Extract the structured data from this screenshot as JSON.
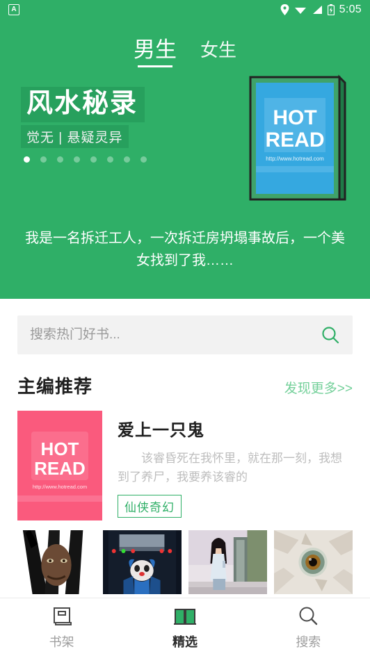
{
  "status_bar": {
    "app_icon": "app-badge-icon",
    "icons": [
      "location-pin-icon",
      "wifi-icon",
      "signal-icon",
      "battery-icon"
    ],
    "time": "5:05"
  },
  "tabs": [
    {
      "label": "男生",
      "active": true
    },
    {
      "label": "女生",
      "active": false
    }
  ],
  "hero": {
    "title": "风水秘录",
    "subtitle": "觉无 | 悬疑灵异",
    "description": "我是一名拆迁工人，一次拆迁房坍塌事故后，一个美女找到了我……",
    "dot_count": 8,
    "active_dot": 0,
    "cover": {
      "line1": "HOT",
      "line2": "READ",
      "url": "http://www.hotread.com",
      "color": "#35A8E0"
    },
    "background_color": "#2FAF67"
  },
  "search": {
    "placeholder": "搜索热门好书...",
    "value": "",
    "icon": "search-icon",
    "icon_color": "#2FAF67"
  },
  "section": {
    "title": "主编推荐",
    "more_label": "发现更多>>",
    "more_color": "#74d09a"
  },
  "featured_book": {
    "title": "爱上一只鬼",
    "description": "该睿昏死在我怀里，就在那一刻，我想到了养尸，我要养该睿的",
    "tag": "仙侠奇幻",
    "cover": {
      "line1": "HOT",
      "line2": "READ",
      "url": "http://www.hotread.com",
      "color": "#FA5A7D"
    }
  },
  "thumbnails": [
    {
      "name": "wolverine-claw-face-cover"
    },
    {
      "name": "blue-clown-horror-cover"
    },
    {
      "name": "girl-on-bridge-cover"
    },
    {
      "name": "cracked-eye-cover"
    }
  ],
  "bottom_nav": [
    {
      "label": "书架",
      "icon": "bookshelf-icon",
      "active": false
    },
    {
      "label": "精选",
      "icon": "open-book-icon",
      "active": true
    },
    {
      "label": "搜索",
      "icon": "search-icon",
      "active": false
    }
  ]
}
